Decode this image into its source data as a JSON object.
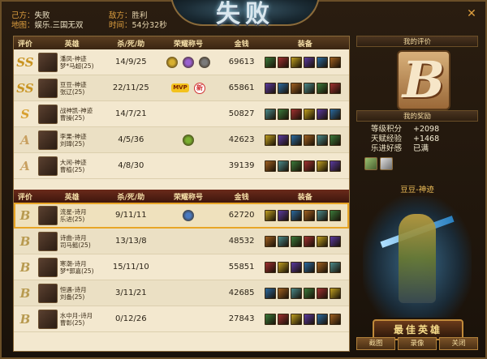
{
  "title": "失败",
  "header": {
    "own_label": "己方：",
    "own_result": "失败",
    "enemy_label": "敌方：",
    "enemy_result": "胜利",
    "map_label": "地图：",
    "map_value": "娱乐.三国无双",
    "time_label": "时间：",
    "time_value": "54分32秒"
  },
  "columns": {
    "rank": "评价",
    "hero": "英雄",
    "kda": "杀/死/助",
    "honor": "荣耀称号",
    "gold": "金钱",
    "equip": "装备"
  },
  "team_win": [
    {
      "rank": "SS",
      "hero": "潘凤-神迹",
      "player": "梦*马超(25)",
      "kda": "14/9/25",
      "honors": [
        "gold-leaf-icon",
        "purple-star-icon",
        "gear-badge-icon"
      ],
      "gold": "69613"
    },
    {
      "rank": "SS",
      "hero": "豆豆-神迹",
      "player": "张辽(25)",
      "kda": "22/11/25",
      "honors": [
        "mvp-badge",
        "xin-badge"
      ],
      "gold": "65861"
    },
    {
      "rank": "S",
      "hero": "战神凯-神迹",
      "player": "曹操(25)",
      "kda": "14/7/21",
      "honors": [],
      "gold": "50827"
    },
    {
      "rank": "A",
      "hero": "李果-神迹",
      "player": "刘璋(25)",
      "kda": "4/5/36",
      "honors": [
        "green-badge-icon"
      ],
      "gold": "42623"
    },
    {
      "rank": "A",
      "hero": "大闲-神迹",
      "player": "曹植(25)",
      "kda": "4/8/30",
      "honors": [],
      "gold": "39139"
    }
  ],
  "team_lose": [
    {
      "rank": "B",
      "hero": "流星-诗月",
      "player": "乐进(25)",
      "kda": "9/11/11",
      "honors": [
        "blue-orb-icon"
      ],
      "gold": "62720",
      "me": true
    },
    {
      "rank": "B",
      "hero": "诗曲-诗月",
      "player": "司马懿(25)",
      "kda": "13/13/8",
      "honors": [],
      "gold": "48532"
    },
    {
      "rank": "B",
      "hero": "寒潮-诗月",
      "player": "梦*郭嘉(25)",
      "kda": "15/11/10",
      "honors": [],
      "gold": "55851"
    },
    {
      "rank": "B",
      "hero": "恒遇-诗月",
      "player": "刘备(25)",
      "kda": "3/11/21",
      "honors": [],
      "gold": "42685"
    },
    {
      "rank": "B",
      "hero": "水中月-诗月",
      "player": "曹彰(25)",
      "kda": "0/12/26",
      "honors": [],
      "gold": "27843"
    }
  ],
  "my_eval": {
    "title": "我的评价",
    "grade": "B"
  },
  "reward": {
    "title": "我的奖励",
    "stats": [
      {
        "k": "等级积分",
        "v": "+2098"
      },
      {
        "k": "天赋经验",
        "v": "+1468"
      },
      {
        "k": "乐进好感",
        "v": "已满"
      }
    ]
  },
  "hero_name": "豆豆-神迹",
  "best_label": "最佳英雄",
  "buttons": {
    "screenshot": "截图",
    "record": "录像",
    "close": "关闭"
  },
  "colors": {
    "accent": "#e8a526",
    "panel": "#f3e8cf",
    "header": "#5a3d20",
    "lose_header": "#6a2a1a"
  }
}
